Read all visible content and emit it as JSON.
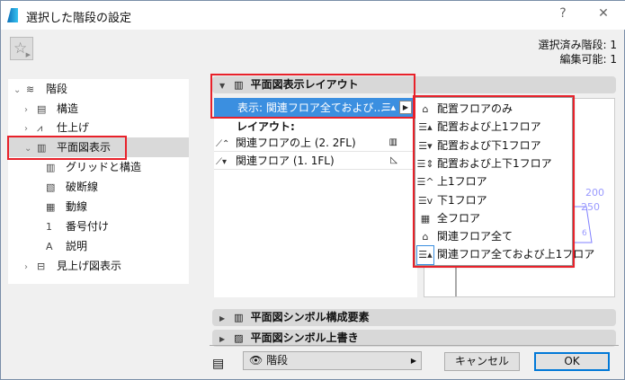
{
  "window": {
    "title": "選択した階段の設定",
    "help": "?",
    "close": "✕"
  },
  "info": {
    "selected": "選択済み階段: 1",
    "editable": "編集可能: 1"
  },
  "tree": [
    {
      "label": "階段",
      "chevron": "⌄"
    },
    {
      "label": "構造",
      "chevron": "›"
    },
    {
      "label": "仕上げ",
      "chevron": "›"
    },
    {
      "label": "平面図表示",
      "chevron": "⌄"
    },
    {
      "label": "グリッドと構造"
    },
    {
      "label": "破断線"
    },
    {
      "label": "動線"
    },
    {
      "label": "番号付け"
    },
    {
      "label": "説明"
    },
    {
      "label": "見上げ図表示",
      "chevron": "›"
    }
  ],
  "sections": {
    "layout": "平面図表示レイアウト",
    "components": "平面図シンボル構成要素",
    "override": "平面図シンボル上書き"
  },
  "layout_panel": {
    "display_row": "表示: 関連フロア全ておよび...",
    "layout_label": "レイアウト:",
    "rows": [
      "関連フロアの上 (2. 2FL)",
      "関連フロア (1. 1FL)"
    ]
  },
  "menu": [
    "配置フロアのみ",
    "配置および上1フロア",
    "配置および下1フロア",
    "配置および上下1フロア",
    "上1フロア",
    "下1フロア",
    "全フロア",
    "関連フロア全て",
    "関連フロア全ておよび上1フロア"
  ],
  "preview": {
    "dim1": "200",
    "dim2": "250",
    "dim3": "6"
  },
  "footer": {
    "layer": "階段",
    "cancel": "キャンセル",
    "ok": "OK"
  },
  "colors": {
    "accent": "#3b8fe0",
    "highlight": "#e8212a",
    "preview_lines": "#8080ff"
  }
}
